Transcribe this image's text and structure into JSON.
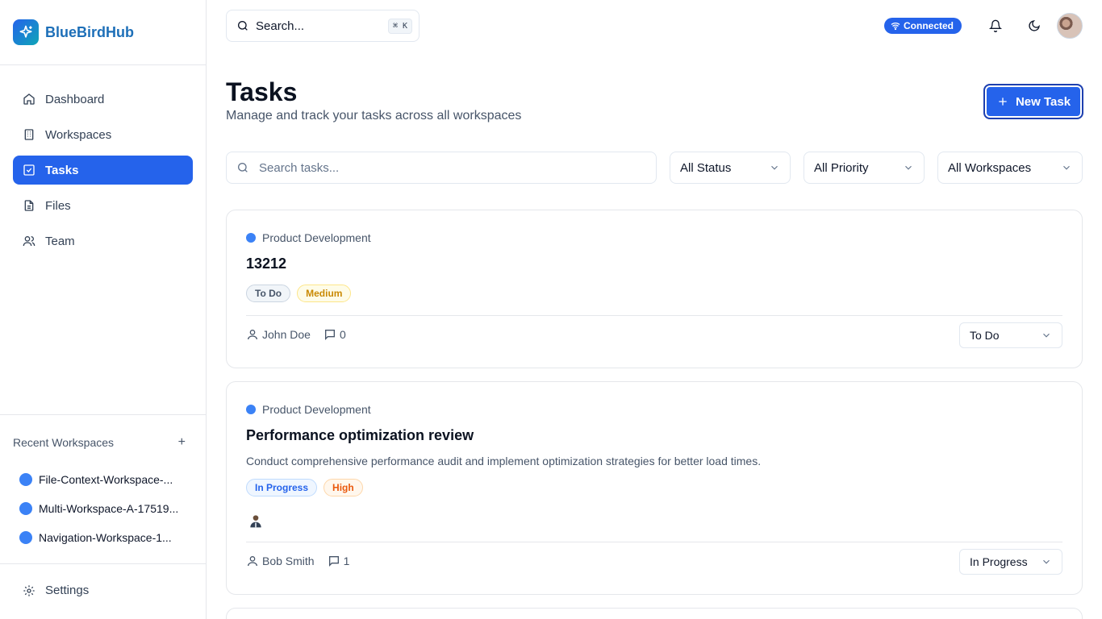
{
  "app": {
    "name": "BlueBirdHub",
    "accent": "#2563eb"
  },
  "sidebar": {
    "items": [
      {
        "label": "Dashboard",
        "icon": "home-icon"
      },
      {
        "label": "Workspaces",
        "icon": "building-icon"
      },
      {
        "label": "Tasks",
        "icon": "check-square-icon",
        "active": true
      },
      {
        "label": "Files",
        "icon": "file-icon"
      },
      {
        "label": "Team",
        "icon": "users-icon"
      }
    ],
    "recent_title": "Recent Workspaces",
    "recent_add": "+",
    "recent": [
      {
        "label": "File-Context-Workspace-..."
      },
      {
        "label": "Multi-Workspace-A-17519..."
      },
      {
        "label": "Navigation-Workspace-1..."
      }
    ],
    "settings_label": "Settings"
  },
  "topbar": {
    "search_placeholder": "Search...",
    "shortcut": "⌘ K",
    "status": "Connected"
  },
  "header": {
    "title": "Tasks",
    "subtitle": "Manage and track your tasks across all workspaces",
    "new_task_label": "New Task"
  },
  "filters": {
    "search_placeholder": "Search tasks...",
    "status": "All Status",
    "priority": "All Priority",
    "workspace": "All Workspaces"
  },
  "tasks": [
    {
      "workspace": "Product Development",
      "title": "13212",
      "status_badge": "To Do",
      "priority_badge": "Medium",
      "assignee": "John Doe",
      "comments": "0",
      "status_select": "To Do"
    },
    {
      "workspace": "Product Development",
      "title": "Performance optimization review",
      "description": "Conduct comprehensive performance audit and implement optimization strategies for better load times.",
      "status_badge": "In Progress",
      "priority_badge": "High",
      "assignee": "Bob Smith",
      "comments": "1",
      "status_select": "In Progress"
    }
  ]
}
